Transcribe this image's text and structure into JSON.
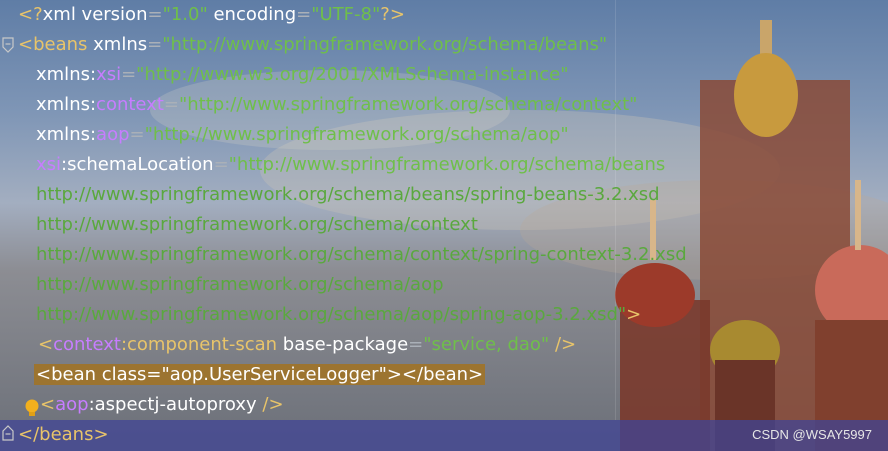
{
  "lines": {
    "l1": {
      "open": "<?",
      "name": "xml",
      "a1": " version",
      "eq1": "=",
      "v1": "\"1.0\"",
      "a2": " encoding",
      "eq2": "=",
      "v2": "\"UTF-8\"",
      "close": "?>"
    },
    "l2": {
      "open": "<",
      "name": "beans",
      "a1": " xmlns",
      "eq1": "=",
      "v1": "\"http://www.springframework.org/schema/beans\""
    },
    "l3": {
      "a": "xmlns:",
      "ns": "xsi",
      "eq": "=",
      "v": "\"http://www.w3.org/2001/XMLSchema-instance\""
    },
    "l4": {
      "a": "xmlns:",
      "ns": "context",
      "eq": "=",
      "v": "\"http://www.springframework.org/schema/context\""
    },
    "l5": {
      "a": "xmlns:",
      "ns": "aop",
      "eq": "=",
      "v": "\"http://www.springframework.org/schema/aop\""
    },
    "l6": {
      "ns": "xsi",
      "a": ":schemaLocation",
      "eq": "=",
      "v": "\"http://www.springframework.org/schema/beans"
    },
    "l7": "http://www.springframework.org/schema/beans/spring-beans-3.2.xsd",
    "l8": "http://www.springframework.org/schema/context",
    "l9": "http://www.springframework.org/schema/context/spring-context-3.2.xsd",
    "l10": "http://www.springframework.org/schema/aop",
    "l11": {
      "v": "http://www.springframework.org/schema/aop/spring-aop-3.2.xsd\"",
      "close": ">"
    },
    "l12": {
      "open": "<",
      "ns": "context",
      "name": ":component-scan",
      "a": " base-package",
      "eq": "=",
      "v": "\"service, dao\"",
      "close": " />"
    },
    "l13": "<bean class=\"aop.UserServiceLogger\"></bean>",
    "l14": {
      "open": "<",
      "ns": "aop",
      "name": ":aspectj-autoproxy",
      "close": " />"
    },
    "l15": {
      "open": "</",
      "name": "beans",
      "close": ">"
    }
  },
  "watermark": "CSDN @WSAY5997",
  "icons": [
    "fold-marker-icon",
    "lightbulb-icon"
  ],
  "colors": {
    "tag": "#e8c46a",
    "namespace": "#c77dff",
    "string": "#6fbf4a",
    "highlight": "#9c7430",
    "current_line": "#40449a"
  }
}
